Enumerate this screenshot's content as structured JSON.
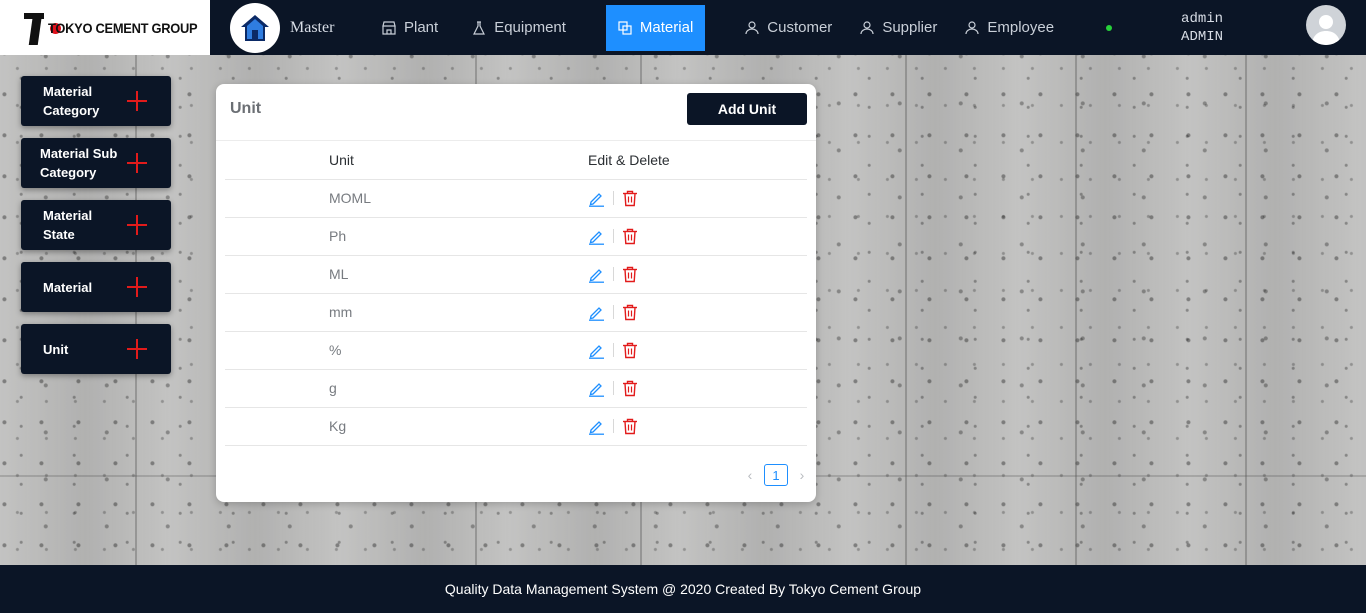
{
  "brand": {
    "name": "TOKYO CEMENT GROUP"
  },
  "nav": {
    "master": "Master",
    "items": [
      {
        "label": "Plant",
        "icon": "store-icon"
      },
      {
        "label": "Equipment",
        "icon": "flask-icon"
      },
      {
        "label": "Material",
        "icon": "copy-icon",
        "active": true
      },
      {
        "label": "Customer",
        "icon": "user-icon"
      },
      {
        "label": "Supplier",
        "icon": "user-icon"
      },
      {
        "label": "Employee",
        "icon": "user-icon"
      }
    ],
    "user": {
      "name": "admin",
      "role": "ADMIN"
    },
    "colors": {
      "navbar": "#0b1526",
      "active": "#1e8fff",
      "status": "#27d13a"
    }
  },
  "sidebar": {
    "items": [
      {
        "label": "Material Category"
      },
      {
        "label": "Material Sub Category"
      },
      {
        "label": "Material State"
      },
      {
        "label": "Material"
      },
      {
        "label": "Unit"
      }
    ],
    "plus_color": "#e21b1b"
  },
  "card": {
    "title": "Unit",
    "add_button": "Add Unit",
    "columns": {
      "unit": "Unit",
      "actions": "Edit & Delete"
    },
    "rows": [
      "MOML",
      "Ph",
      "ML",
      "mm",
      "%",
      "g",
      "Kg"
    ],
    "pagination": {
      "current": "1",
      "prev": "‹",
      "next": "›"
    }
  },
  "footer": {
    "text": "Quality Data Management System @ 2020 Created By Tokyo Cement Group"
  }
}
